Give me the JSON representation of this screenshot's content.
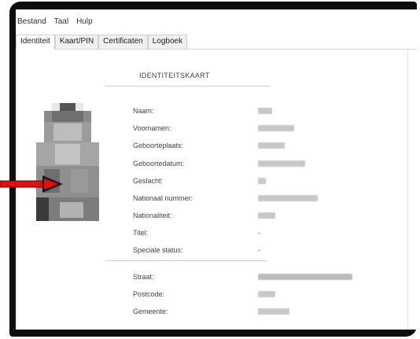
{
  "menu": {
    "items": [
      "Bestand",
      "Taal",
      "Hulp"
    ]
  },
  "tabs": [
    "Identiteit",
    "Kaart/PIN",
    "Certificaten",
    "Logboek"
  ],
  "identity": {
    "section_title": "IDENTITEITSKAART",
    "labels": {
      "naam": "Naam:",
      "voornamen": "Voornamen:",
      "geboorteplaats": "Geboorteplaats:",
      "geboortedatum": "Geboortedatum:",
      "geslacht": "Geslacht:",
      "nationaal_nummer": "Nationaal nummer:",
      "nationaliteit": "Nationaliteit:",
      "titel": "Titel:",
      "speciale_status": "Speciale status:"
    },
    "values": {
      "titel": "-",
      "speciale_status": "-"
    }
  },
  "address": {
    "labels": {
      "straat": "Straat:",
      "postcode": "Postcode:",
      "gemeente": "Gemeente:"
    }
  },
  "colors": {
    "frame": "#0d0d0d",
    "arrow": "#e01010",
    "blur": "#c8c8c8"
  },
  "icons": {
    "photo": "pixelated-portrait",
    "arrow": "right-arrow-icon"
  }
}
